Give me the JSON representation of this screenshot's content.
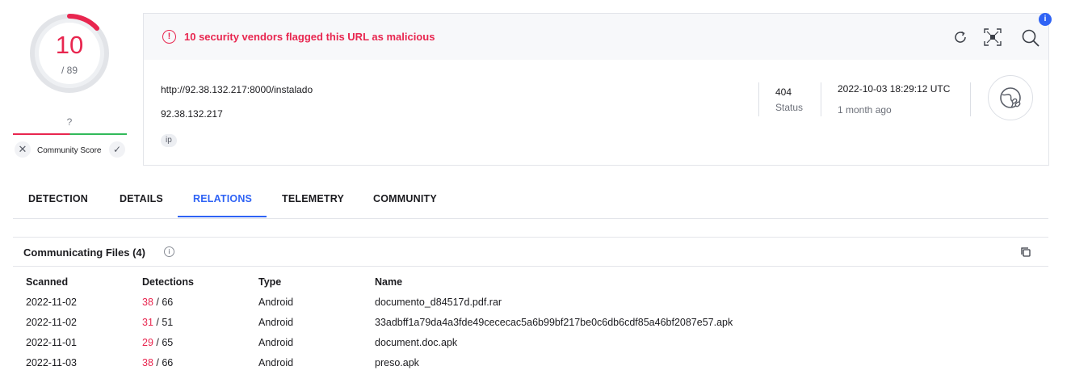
{
  "score": {
    "detections": "10",
    "total": "/ 89",
    "community_unknown": "?",
    "community_label": "Community Score"
  },
  "alert": {
    "icon": "exclamation-circle-icon",
    "text": "10 security vendors flagged this URL as malicious",
    "notification_count": "i"
  },
  "actions": [
    "reanalyze-icon",
    "similar-icon",
    "search-icon"
  ],
  "url_info": {
    "url": "http://92.38.132.217:8000/instalado",
    "host": "92.38.132.217",
    "tag": "ip",
    "status_code": "404",
    "status_label": "Status",
    "date": "2022-10-03 18:29:12 UTC",
    "relative_date": "1 month ago"
  },
  "tabs": [
    {
      "label": "DETECTION",
      "active": false
    },
    {
      "label": "DETAILS",
      "active": false
    },
    {
      "label": "RELATIONS",
      "active": true
    },
    {
      "label": "TELEMETRY",
      "active": false
    },
    {
      "label": "COMMUNITY",
      "active": false
    }
  ],
  "communicating_files": {
    "title": "Communicating Files (4)",
    "columns": [
      "Scanned",
      "Detections",
      "Type",
      "Name"
    ],
    "rows": [
      {
        "scanned": "2022-11-02",
        "positives": "38",
        "total": " / 66",
        "type": "Android",
        "name": "documento_d84517d.pdf.rar"
      },
      {
        "scanned": "2022-11-02",
        "positives": "31",
        "total": " / 51",
        "type": "Android",
        "name": "33adbff1a79da4a3fde49cececac5a6b99bf217be0c6db6cdf85a46bf2087e57.apk"
      },
      {
        "scanned": "2022-11-01",
        "positives": "29",
        "total": " / 65",
        "type": "Android",
        "name": "document.doc.apk"
      },
      {
        "scanned": "2022-11-03",
        "positives": "38",
        "total": " / 66",
        "type": "Android",
        "name": "preso.apk"
      }
    ]
  },
  "colors": {
    "malicious": "#e8264f",
    "accent": "#2f63f5",
    "harmless": "#32b95a"
  }
}
